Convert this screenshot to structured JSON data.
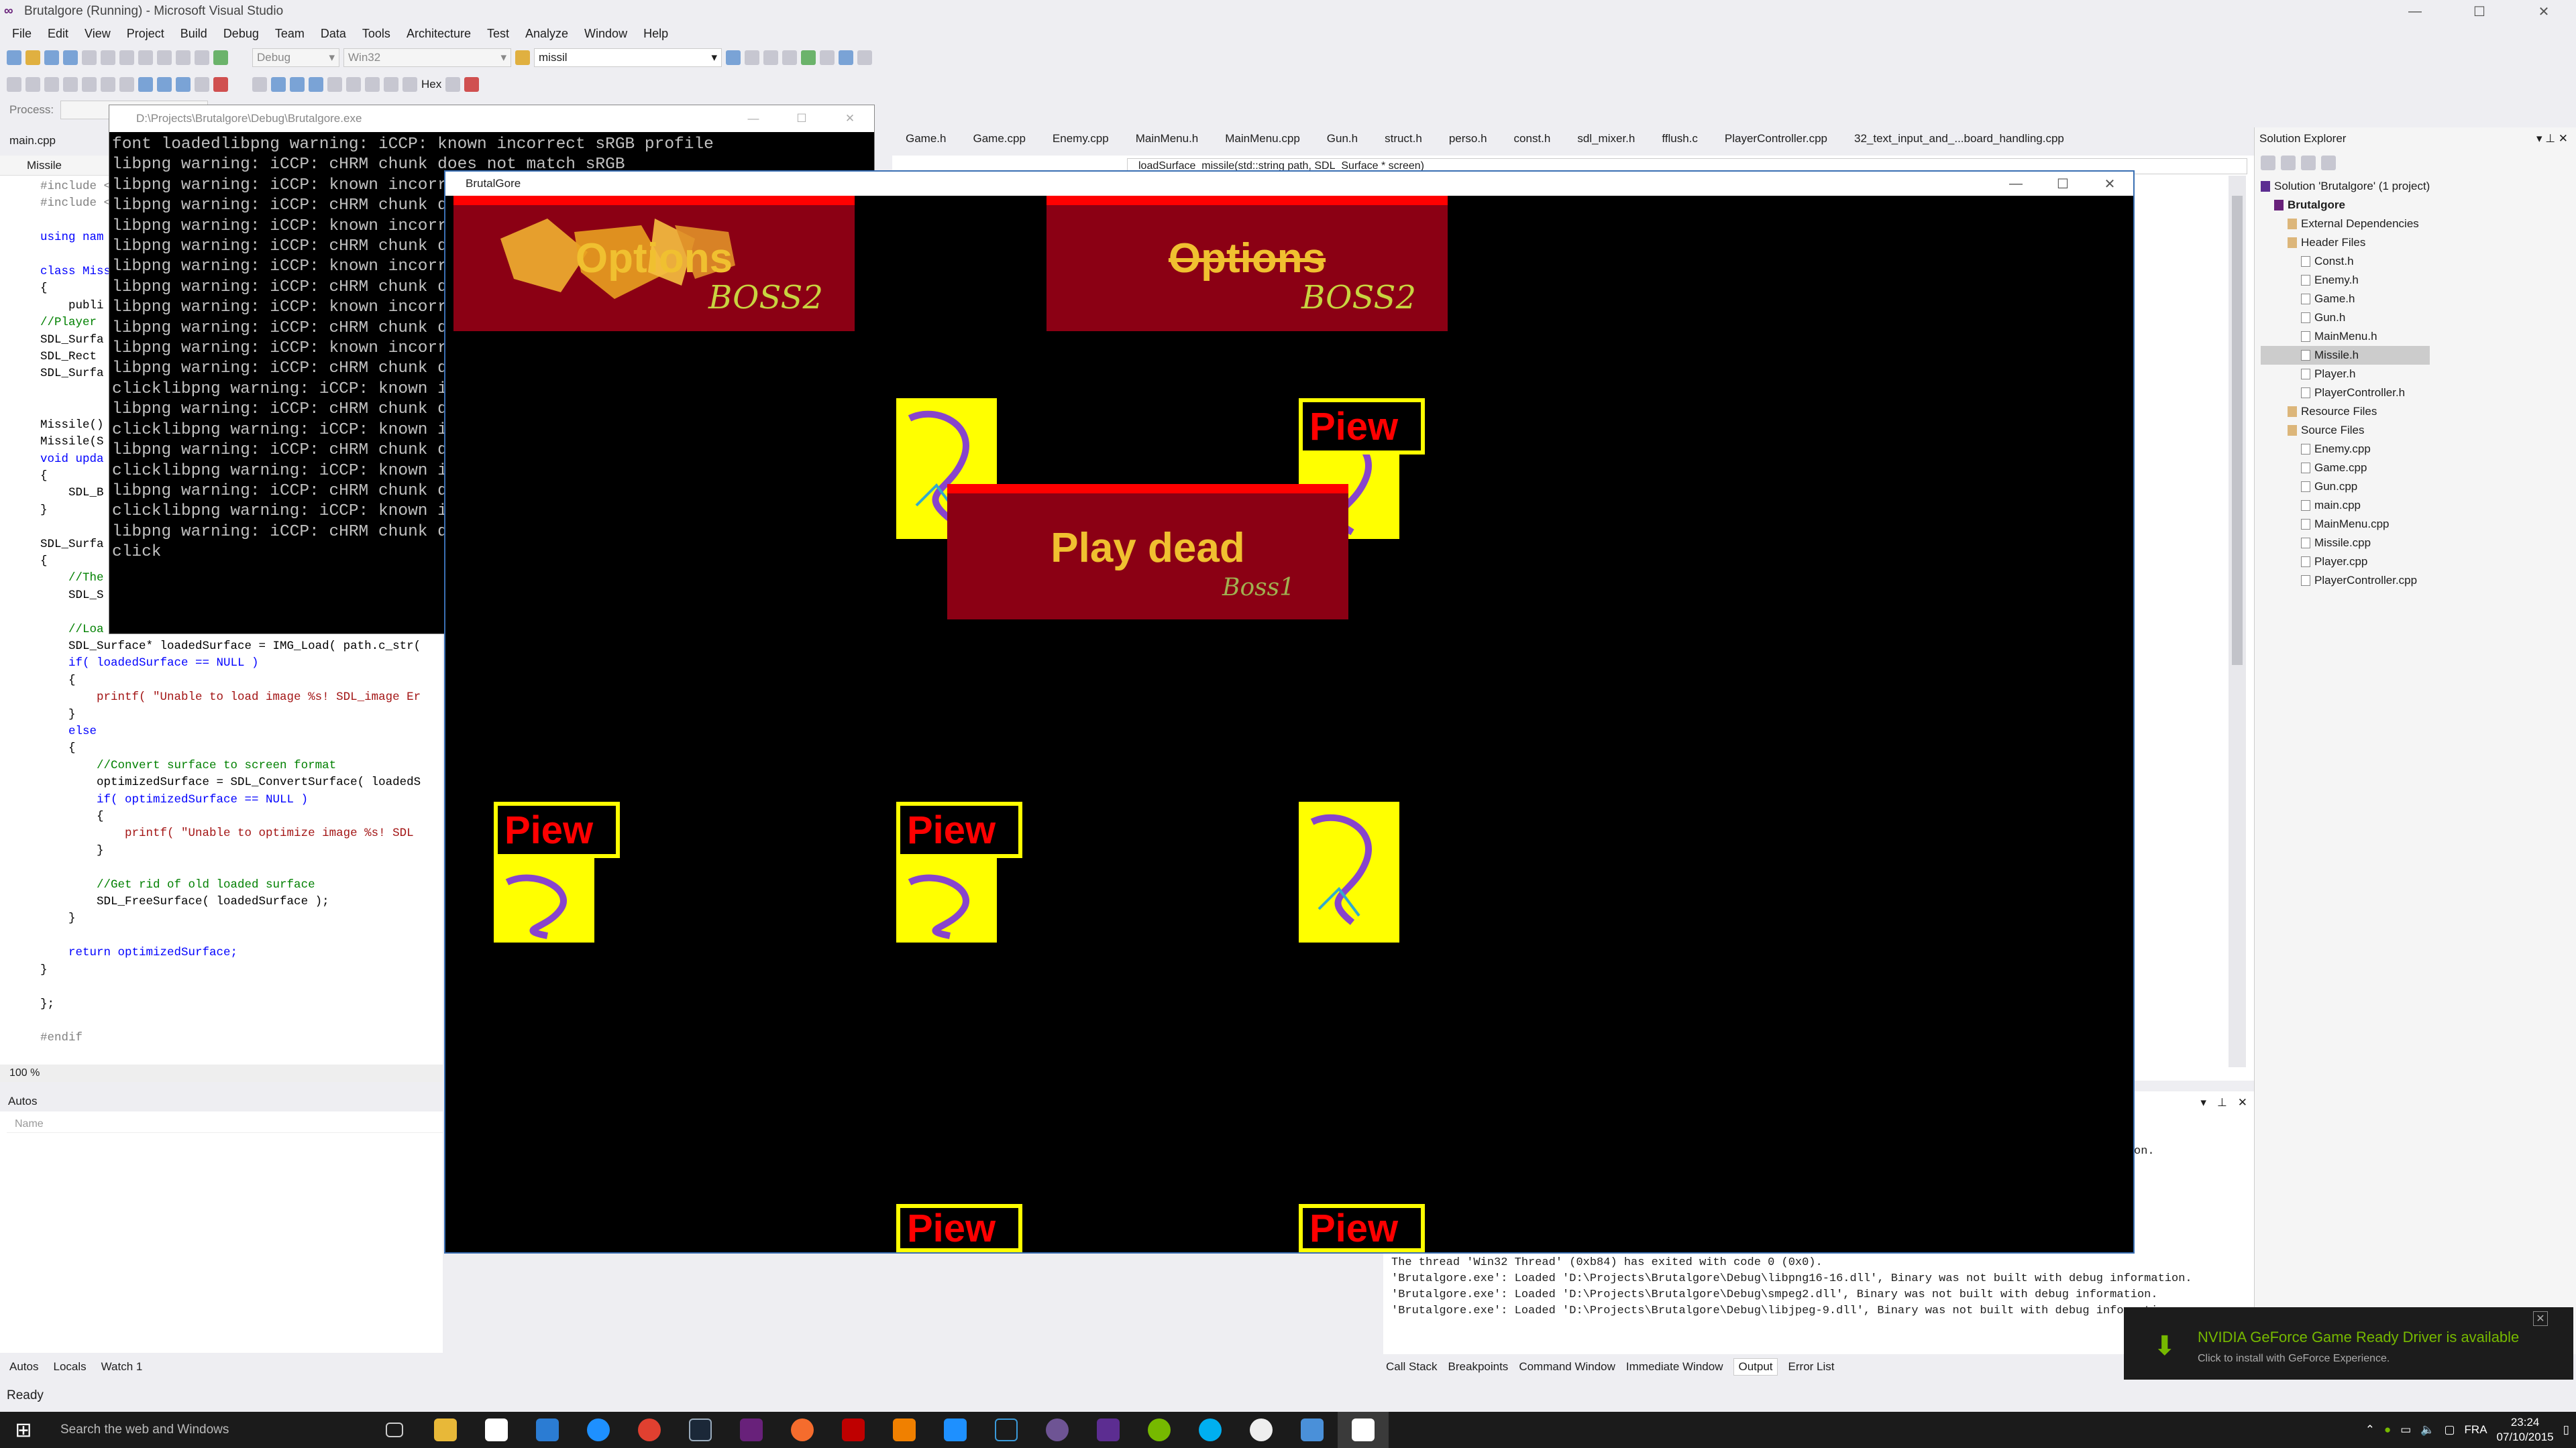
{
  "vs": {
    "title": "Brutalgore (Running) - Microsoft Visual Studio",
    "menu": [
      "File",
      "Edit",
      "View",
      "Project",
      "Build",
      "Debug",
      "Team",
      "Data",
      "Tools",
      "Architecture",
      "Test",
      "Analyze",
      "Window",
      "Help"
    ],
    "config": "Debug",
    "platform": "Win32",
    "find_box": "missil",
    "hex_label": "Hex",
    "process_label": "Process:",
    "left_tabs": "main.cpp",
    "left_nav": "Missile",
    "doc_tabs": [
      "Game.h",
      "Game.cpp",
      "Enemy.cpp",
      "MainMenu.h",
      "MainMenu.cpp",
      "Gun.h",
      "struct.h",
      "perso.h",
      "const.h",
      "sdl_mixer.h",
      "fflush.c",
      "PlayerController.cpp",
      "32_text_input_and_...board_handling.cpp"
    ],
    "right_nav": "loadSurface_missile(std::string path, SDL_Surface * screen)",
    "zoom": "100 %"
  },
  "editor": {
    "lines": [
      "#include <",
      "#include <",
      "",
      "using nam",
      "",
      "class Missi",
      "{",
      "    publi",
      "//Player",
      "SDL_Surfa",
      "SDL_Rect",
      "SDL_Surfa",
      "",
      "",
      "Missile()",
      "Missile(S",
      "void upda",
      "{",
      "    SDL_B",
      "}",
      "",
      "SDL_Surfa",
      "{",
      "    //The",
      "    SDL_S",
      "",
      "    //Loa",
      "    SDL_Surface* loadedSurface = IMG_Load( path.c_str(",
      "    if( loadedSurface == NULL )",
      "    {",
      "        printf( \"Unable to load image %s! SDL_image Er",
      "    }",
      "    else",
      "    {",
      "        //Convert surface to screen format",
      "        optimizedSurface = SDL_ConvertSurface( loadedS",
      "        if( optimizedSurface == NULL )",
      "        {",
      "            printf( \"Unable to optimize image %s! SDL",
      "        }",
      "",
      "        //Get rid of old loaded surface",
      "        SDL_FreeSurface( loadedSurface );",
      "    }",
      "",
      "    return optimizedSurface;",
      "}",
      "",
      "};",
      "",
      "#endif"
    ]
  },
  "console": {
    "title": "D:\\Projects\\Brutalgore\\Debug\\Brutalgore.exe",
    "lines": [
      "font loadedlibpng warning: iCCP: known incorrect sRGB profile",
      "libpng warning: iCCP: cHRM chunk does not match sRGB",
      "libpng warning: iCCP: known incorre",
      "libpng warning: iCCP: cHRM chunk do",
      "libpng warning: iCCP: known incorre",
      "libpng warning: iCCP: cHRM chunk do",
      "libpng warning: iCCP: known incorre",
      "libpng warning: iCCP: cHRM chunk do",
      "libpng warning: iCCP: known incorre",
      "libpng warning: iCCP: cHRM chunk do",
      "libpng warning: iCCP: known incorre",
      "libpng warning: iCCP: cHRM chunk do",
      "clicklibpng warning: iCCP: known in",
      "libpng warning: iCCP: cHRM chunk do",
      "clicklibpng warning: iCCP: known in",
      "libpng warning: iCCP: cHRM chunk do",
      "clicklibpng warning: iCCP: known in",
      "libpng warning: iCCP: cHRM chunk do",
      "clicklibpng warning: iCCP: known in",
      "libpng warning: iCCP: cHRM chunk do",
      "click"
    ]
  },
  "autos": {
    "title": "Autos",
    "col_name": "Name",
    "tabs": [
      "Autos",
      "Locals",
      "Watch 1"
    ]
  },
  "output": {
    "trunc": "rmation.",
    "lines": [
      "The thread 'Win32 Thread' (0xb84) has exited with code 0 (0x0).",
      "'Brutalgore.exe': Loaded 'D:\\Projects\\Brutalgore\\Debug\\libpng16-16.dll', Binary was not built with debug information.",
      "'Brutalgore.exe': Loaded 'D:\\Projects\\Brutalgore\\Debug\\smpeg2.dll', Binary was not built with debug information.",
      "'Brutalgore.exe': Loaded 'D:\\Projects\\Brutalgore\\Debug\\libjpeg-9.dll', Binary was not built with debug information."
    ],
    "tabs": [
      "Call Stack",
      "Breakpoints",
      "Command Window",
      "Immediate Window",
      "Output",
      "Error List"
    ],
    "selected_tab": "Output"
  },
  "solution": {
    "title": "Solution Explorer",
    "tree": [
      {
        "label": "Solution 'Brutalgore' (1 project)",
        "indent": 0,
        "icon": "sln"
      },
      {
        "label": "Brutalgore",
        "indent": 1,
        "icon": "proj",
        "bold": true
      },
      {
        "label": "External Dependencies",
        "indent": 2,
        "icon": "folder"
      },
      {
        "label": "Header Files",
        "indent": 2,
        "icon": "folder"
      },
      {
        "label": "Const.h",
        "indent": 3,
        "icon": "file"
      },
      {
        "label": "Enemy.h",
        "indent": 3,
        "icon": "file"
      },
      {
        "label": "Game.h",
        "indent": 3,
        "icon": "file"
      },
      {
        "label": "Gun.h",
        "indent": 3,
        "icon": "file"
      },
      {
        "label": "MainMenu.h",
        "indent": 3,
        "icon": "file"
      },
      {
        "label": "Missile.h",
        "indent": 3,
        "icon": "file",
        "selected": true
      },
      {
        "label": "Player.h",
        "indent": 3,
        "icon": "file"
      },
      {
        "label": "PlayerController.h",
        "indent": 3,
        "icon": "file"
      },
      {
        "label": "Resource Files",
        "indent": 2,
        "icon": "folder"
      },
      {
        "label": "Source Files",
        "indent": 2,
        "icon": "folder"
      },
      {
        "label": "Enemy.cpp",
        "indent": 3,
        "icon": "file"
      },
      {
        "label": "Game.cpp",
        "indent": 3,
        "icon": "file"
      },
      {
        "label": "Gun.cpp",
        "indent": 3,
        "icon": "file"
      },
      {
        "label": "main.cpp",
        "indent": 3,
        "icon": "file"
      },
      {
        "label": "MainMenu.cpp",
        "indent": 3,
        "icon": "file"
      },
      {
        "label": "Missile.cpp",
        "indent": 3,
        "icon": "file"
      },
      {
        "label": "Player.cpp",
        "indent": 3,
        "icon": "file"
      },
      {
        "label": "PlayerController.cpp",
        "indent": 3,
        "icon": "file"
      }
    ]
  },
  "game": {
    "title": "BrutalGore",
    "bosses": [
      {
        "label": "Options",
        "tag": "BOSS2",
        "health": 1.0
      },
      {
        "label": "Options",
        "tag": "BOSS2",
        "health": 1.0
      },
      {
        "label": "Play dead",
        "tag": "Boss1",
        "health": 1.0
      }
    ],
    "piew_label": "Piew"
  },
  "notification": {
    "title": "NVIDIA GeForce Game Ready Driver is available",
    "subtitle": "Click to install with GeForce Experience."
  },
  "status": "Ready",
  "taskbar": {
    "search": "Search the web and Windows",
    "lang": "FRA",
    "time": "23:24",
    "date": "07/10/2015"
  },
  "colors": {
    "boss_bg": "#8b0014",
    "boss_text": "#f0c030",
    "health_bar": "#ff0000",
    "enemy": "#ffff00",
    "piew_text": "#ff0000",
    "nvidia": "#76b900"
  }
}
